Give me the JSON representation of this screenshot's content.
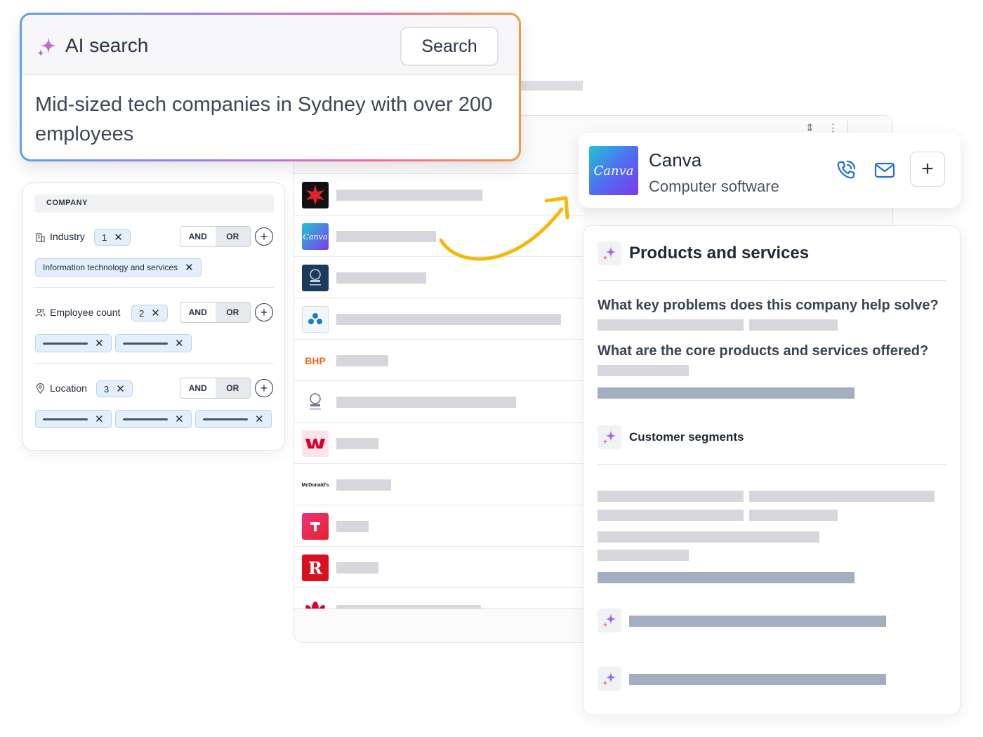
{
  "ai_search": {
    "title": "AI search",
    "button_label": "Search",
    "query": "Mid-sized tech companies in Sydney with over 200 employees"
  },
  "filters": {
    "section_label": "COMPANY",
    "and_label": "AND",
    "or_label": "OR",
    "groups": [
      {
        "label": "Industry",
        "count": "1",
        "chips": [
          "Information technology and services"
        ]
      },
      {
        "label": "Employee count",
        "count": "2"
      },
      {
        "label": "Location",
        "count": "3"
      }
    ]
  },
  "company_list": {
    "logo_texts": {
      "canva": "Canva",
      "bhp": "BHP",
      "mcdonalds": "McDonald's",
      "rest": "R"
    }
  },
  "company_card": {
    "name": "Canva",
    "category": "Computer software",
    "logo_text": "Canva"
  },
  "details": {
    "section_title": "Products and services",
    "questions": [
      "What key problems does this company help solve?",
      "What are the core products and services offered?"
    ],
    "subsection_title": "Customer segments"
  },
  "colors": {
    "accent_blue": "#1d6fd8",
    "arrow_yellow": "#f5b80a",
    "sparkle_purple": "#9b6cf2",
    "sparkle_pink": "#e86aa8"
  },
  "icons": {
    "sparkle": "sparkle-icon",
    "phone": "phone-icon",
    "email": "envelope-icon",
    "add": "plus-icon",
    "industry": "building-icon",
    "employees": "people-icon",
    "location": "map-pin-icon",
    "remove": "close-icon",
    "sort": "sort-icon",
    "more": "more-vertical-icon"
  }
}
